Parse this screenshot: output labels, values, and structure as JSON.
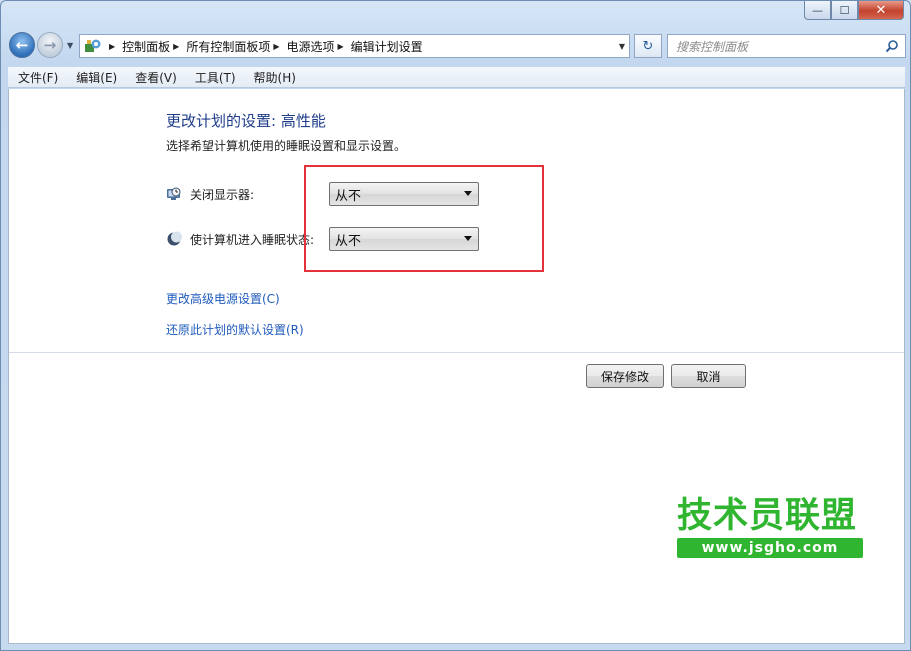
{
  "window": {
    "caption": {
      "minimize": "—",
      "maximize": "☐",
      "close": "✕"
    }
  },
  "address_bar": {
    "breadcrumbs": [
      "控制面板",
      "所有控制面板项",
      "电源选项",
      "编辑计划设置"
    ]
  },
  "search": {
    "placeholder": "搜索控制面板"
  },
  "menu": {
    "items": [
      "文件(F)",
      "编辑(E)",
      "查看(V)",
      "工具(T)",
      "帮助(H)"
    ]
  },
  "main": {
    "heading": "更改计划的设置: 高性能",
    "subtext": "选择希望计算机使用的睡眠设置和显示设置。",
    "settings": [
      {
        "label": "关闭显示器:",
        "value": "从不",
        "icon": "monitor-clock-icon"
      },
      {
        "label": "使计算机进入睡眠状态:",
        "value": "从不",
        "icon": "moon-icon"
      }
    ],
    "links": [
      "更改高级电源设置(C)",
      "还原此计划的默认设置(R)"
    ],
    "buttons": {
      "save": "保存修改",
      "cancel": "取消"
    }
  },
  "watermark": {
    "title": "技术员联盟",
    "url": "www.jsgho.com"
  },
  "colors": {
    "highlight": "#e3323c",
    "link": "#1f5bbd",
    "watermark": "#2fb52f"
  }
}
